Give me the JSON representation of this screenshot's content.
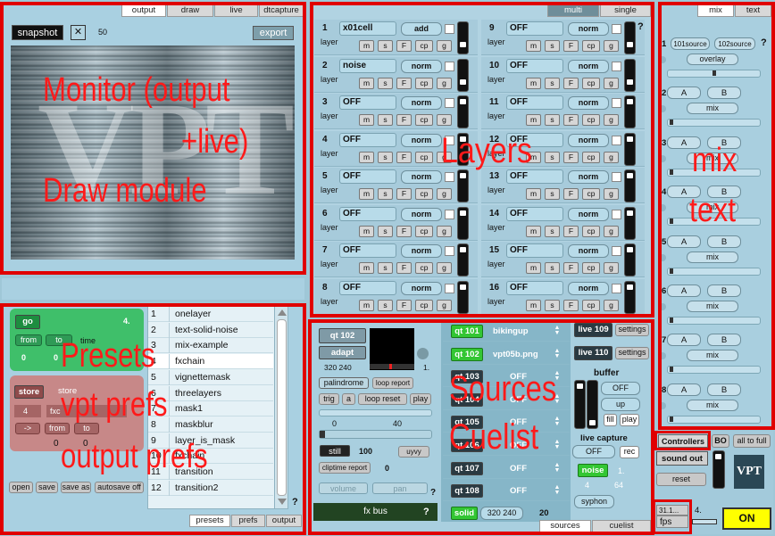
{
  "monitor": {
    "tabs": [
      "output",
      "draw",
      "live",
      "dtcapture"
    ],
    "snapshot_label": "snapshot",
    "close_glyph": "✕",
    "fps_value": "50",
    "export_label": "export",
    "watermark": "VPT"
  },
  "layers": {
    "tabs": [
      "multi",
      "single"
    ],
    "help": "?",
    "layer_word": "layer",
    "btn_m": "m",
    "btn_s": "s",
    "btn_f": "F",
    "btn_cp": "cp",
    "btn_g": "g",
    "left": [
      {
        "num": "1",
        "name": "x01cell",
        "mode": "add"
      },
      {
        "num": "2",
        "name": "noise",
        "mode": "norm"
      },
      {
        "num": "3",
        "name": "OFF",
        "mode": "norm"
      },
      {
        "num": "4",
        "name": "OFF",
        "mode": "norm"
      },
      {
        "num": "5",
        "name": "OFF",
        "mode": "norm"
      },
      {
        "num": "6",
        "name": "OFF",
        "mode": "norm"
      },
      {
        "num": "7",
        "name": "OFF",
        "mode": "norm"
      },
      {
        "num": "8",
        "name": "OFF",
        "mode": "norm"
      }
    ],
    "right": [
      {
        "num": "9",
        "name": "OFF",
        "mode": "norm"
      },
      {
        "num": "10",
        "name": "OFF",
        "mode": "norm"
      },
      {
        "num": "11",
        "name": "OFF",
        "mode": "norm"
      },
      {
        "num": "12",
        "name": "OFF",
        "mode": "norm"
      },
      {
        "num": "13",
        "name": "OFF",
        "mode": "norm"
      },
      {
        "num": "14",
        "name": "OFF",
        "mode": "norm"
      },
      {
        "num": "15",
        "name": "OFF",
        "mode": "norm"
      },
      {
        "num": "16",
        "name": "OFF",
        "mode": "norm"
      }
    ]
  },
  "mix": {
    "tabs": [
      "mix",
      "text"
    ],
    "help": "?",
    "rows": [
      {
        "num": "1",
        "a": "101source",
        "b": "102source",
        "mode": "overlay"
      },
      {
        "num": "2",
        "a": "A",
        "b": "B",
        "mode": "mix"
      },
      {
        "num": "3",
        "a": "A",
        "b": "B",
        "mode": "mix"
      },
      {
        "num": "4",
        "a": "A",
        "b": "B",
        "mode": "mix"
      },
      {
        "num": "5",
        "a": "A",
        "b": "B",
        "mode": "mix"
      },
      {
        "num": "6",
        "a": "A",
        "b": "B",
        "mode": "mix"
      },
      {
        "num": "7",
        "a": "A",
        "b": "B",
        "mode": "mix"
      },
      {
        "num": "8",
        "a": "A",
        "b": "B",
        "mode": "mix"
      }
    ]
  },
  "presets": {
    "go_label": "go",
    "current": "4.",
    "from_label": "from",
    "to_label": "to",
    "time_label": "time",
    "from_val": "0",
    "to_val": "0",
    "store_label": "store",
    "store_text": "store",
    "store_num": "4",
    "store_name": "fxc",
    "arrow_label": "->",
    "from2": "from",
    "to2": "to",
    "from2_val": "0",
    "to2_val": "0",
    "open": "open",
    "save": "save",
    "saveas": "save as",
    "autosave": "autosave off",
    "list": [
      {
        "n": "1",
        "t": "onelayer"
      },
      {
        "n": "2",
        "t": "text-solid-noise"
      },
      {
        "n": "3",
        "t": "mix-example"
      },
      {
        "n": "4",
        "t": "fxchain"
      },
      {
        "n": "5",
        "t": "vignettemask"
      },
      {
        "n": "6",
        "t": "threelayers"
      },
      {
        "n": "7",
        "t": "mask1"
      },
      {
        "n": "8",
        "t": "maskblur"
      },
      {
        "n": "9",
        "t": "layer_is_mask"
      },
      {
        "n": "10",
        "t": "fxchain"
      },
      {
        "n": "11",
        "t": "transition"
      },
      {
        "n": "12",
        "t": "transition2"
      }
    ],
    "help": "?",
    "tabs": [
      "presets",
      "prefs",
      "output"
    ]
  },
  "sources": {
    "src_name": "qt 102",
    "adapt": "adapt",
    "res": "320 240",
    "one": "1.",
    "palindrome": "palindrome",
    "loop_report": "loop report",
    "trig": "trig",
    "a": "a",
    "loop_reset": "loop reset",
    "play": "play",
    "range_start": "0",
    "range_end": "40",
    "still": "still",
    "still_val": "100",
    "uyvy": "uyvy",
    "cliptime": "cliptime report",
    "cliptime_val": "0",
    "volume": "volume",
    "pan": "pan",
    "fxbus": "fx bus",
    "help": "?",
    "slots": [
      {
        "id": "qt 101",
        "name": "bikingup",
        "active": true
      },
      {
        "id": "qt 102",
        "name": "vpt05b.png",
        "active": true
      },
      {
        "id": "qt 103",
        "name": "OFF",
        "active": false
      },
      {
        "id": "qt 104",
        "name": "OFF",
        "active": false
      },
      {
        "id": "qt 105",
        "name": "OFF",
        "active": false
      },
      {
        "id": "qt 106",
        "name": "OFF",
        "active": false
      },
      {
        "id": "qt 107",
        "name": "OFF",
        "active": false
      },
      {
        "id": "qt 108",
        "name": "OFF",
        "active": false
      }
    ],
    "solid": "solid",
    "solid_res": "320 240",
    "solid_num": "20",
    "live109": "live 109",
    "live110": "live 110",
    "settings": "settings",
    "buffer": "buffer",
    "buf_off": "OFF",
    "up": "up",
    "fill": "fill",
    "play2": "play",
    "live_capture": "live capture",
    "cap_off": "OFF",
    "rec": "rec",
    "noise": "noise",
    "noise_one": "1.",
    "noise_a": "4",
    "noise_b": "64",
    "syphon": "syphon",
    "tabs": [
      "sources",
      "cuelist"
    ]
  },
  "controls": {
    "controllers": "Controllers",
    "bo": "BO",
    "all_to_full": "all to full",
    "sound_out": "sound out",
    "reset": "reset",
    "logo": "VPT",
    "fps_val": "31.1...",
    "fps": "fps",
    "count": "4.",
    "on": "ON"
  },
  "annotations": {
    "monitor_1": "Monitor (output",
    "monitor_2": "+live)",
    "monitor_3": "Draw module",
    "layers": "Layers",
    "mix_1": "mix",
    "mix_2": "text",
    "presets_1": "Presets",
    "presets_2": "vpt prefs",
    "presets_3": "output prefs",
    "sources_1": "Sources",
    "sources_2": "Cuelist"
  }
}
